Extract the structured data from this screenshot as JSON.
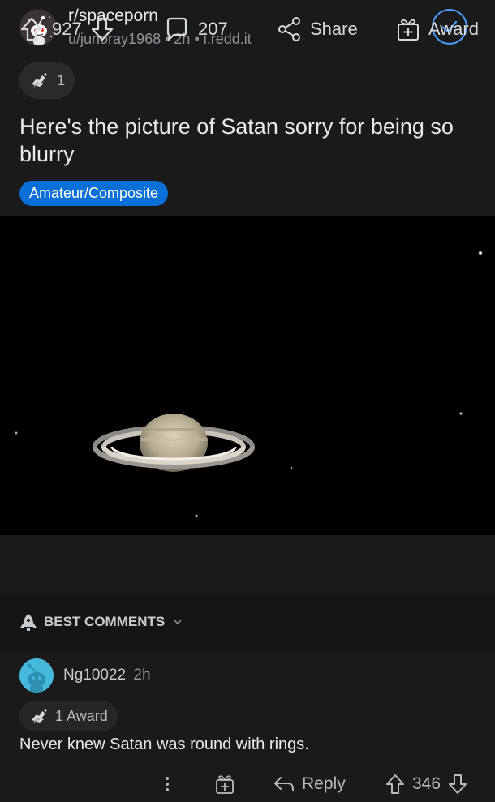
{
  "post": {
    "subreddit": "r/spaceporn",
    "author": "u/junoray1968",
    "age": "2h",
    "domain": "i.redd.it",
    "award_count": "1",
    "title": "Here's the picture of Satan sorry for being so blurry",
    "flair": "Amateur/Composite",
    "image_alt_icon": "saturn-image"
  },
  "actions": {
    "upvotes": "927",
    "comments": "207",
    "share_label": "Share",
    "award_label": "Award"
  },
  "sort": {
    "label": "BEST COMMENTS"
  },
  "comment": {
    "username": "Ng10022",
    "age": "2h",
    "award_label": "1 Award",
    "body": "Never knew Satan was round with rings.",
    "reply_label": "Reply",
    "score": "346"
  },
  "colors": {
    "accent_blue": "#0a6fd6",
    "check_blue": "#4a9dff",
    "background": "#1a1a1b"
  }
}
